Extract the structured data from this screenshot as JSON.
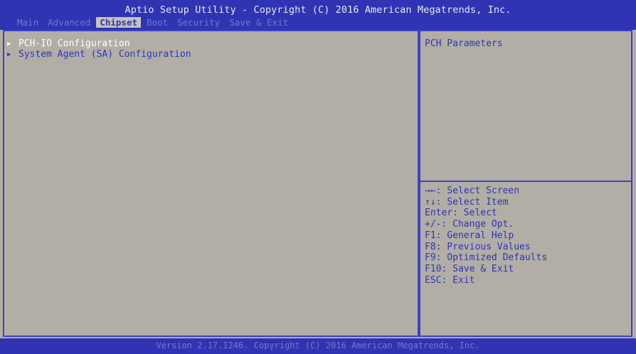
{
  "header": {
    "title": "Aptio Setup Utility - Copyright (C) 2016 American Megatrends, Inc.",
    "tabs": [
      {
        "label": "Main",
        "active": false
      },
      {
        "label": "Advanced",
        "active": false
      },
      {
        "label": "Chipset",
        "active": true
      },
      {
        "label": "Boot",
        "active": false
      },
      {
        "label": "Security",
        "active": false
      },
      {
        "label": "Save & Exit",
        "active": false
      }
    ]
  },
  "menu": {
    "items": [
      {
        "label": "PCH-IO Configuration",
        "selected": true,
        "icon": "right-triangle-icon"
      },
      {
        "label": "System Agent (SA) Configuration",
        "selected": false,
        "icon": "right-triangle-icon"
      }
    ]
  },
  "help": {
    "description": "PCH Parameters",
    "keys": [
      "→←: Select Screen",
      "↑↓: Select Item",
      "Enter: Select",
      "+/-: Change Opt.",
      "F1: General Help",
      "F8: Previous Values",
      "F9: Optimized Defaults",
      "F10: Save & Exit",
      "ESC: Exit"
    ]
  },
  "footer": {
    "text": "Version 2.17.1246. Copyright (C) 2016 American Megatrends, Inc."
  },
  "colors": {
    "background": "#b2aea6",
    "bar_blue": "#2e34b2",
    "text_blue": "#2e34b2",
    "selected": "#ffffff"
  }
}
